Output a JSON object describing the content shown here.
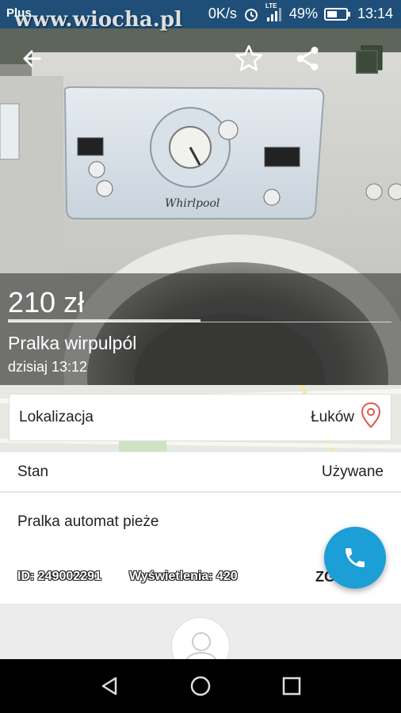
{
  "status_bar": {
    "carrier": "Plus",
    "watermark": "www.wiocha.pl",
    "speed": "0K/s",
    "network": "LTE",
    "battery": "49%",
    "time": "13:14"
  },
  "toolbar": {
    "back_icon": "arrow-back-icon",
    "favorite_icon": "star-outline-icon",
    "share_icon": "share-icon",
    "gallery_icon": "gallery-icon"
  },
  "listing": {
    "price": "210 zł",
    "title": "Pralka wirpulpól",
    "date": "dzisiaj 13:12",
    "image_brand_text": "Whirlpool"
  },
  "location": {
    "label": "Lokalizacja",
    "value": "Łuków"
  },
  "condition": {
    "label": "Stan",
    "value": "Używane"
  },
  "description": {
    "text": "Pralka automat pieże",
    "id_text": "ID: 249002291",
    "views_text": "Wyświetlenia: 420",
    "report_text": "ZG"
  },
  "colors": {
    "status_bar": "#1f4f78",
    "fab": "#1c9ed6",
    "pin": "#e2574c"
  },
  "nav": {
    "back": "nav-back-icon",
    "home": "nav-home-icon",
    "recents": "nav-recents-icon"
  }
}
